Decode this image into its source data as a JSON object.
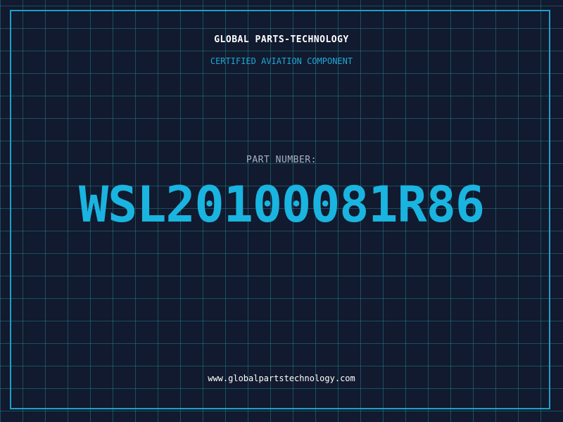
{
  "header": {
    "company": "GLOBAL PARTS-TECHNOLOGY",
    "tagline": "CERTIFIED AVIATION COMPONENT"
  },
  "part": {
    "label": "PART NUMBER:",
    "number": "WSL20100081R86"
  },
  "footer": {
    "website": "www.globalpartstechnology.com"
  },
  "colors": {
    "background": "#111a2e",
    "grid": "#22788c",
    "accent": "#1ab4e0",
    "text": "#ffffff",
    "muted": "#aab3c2"
  }
}
